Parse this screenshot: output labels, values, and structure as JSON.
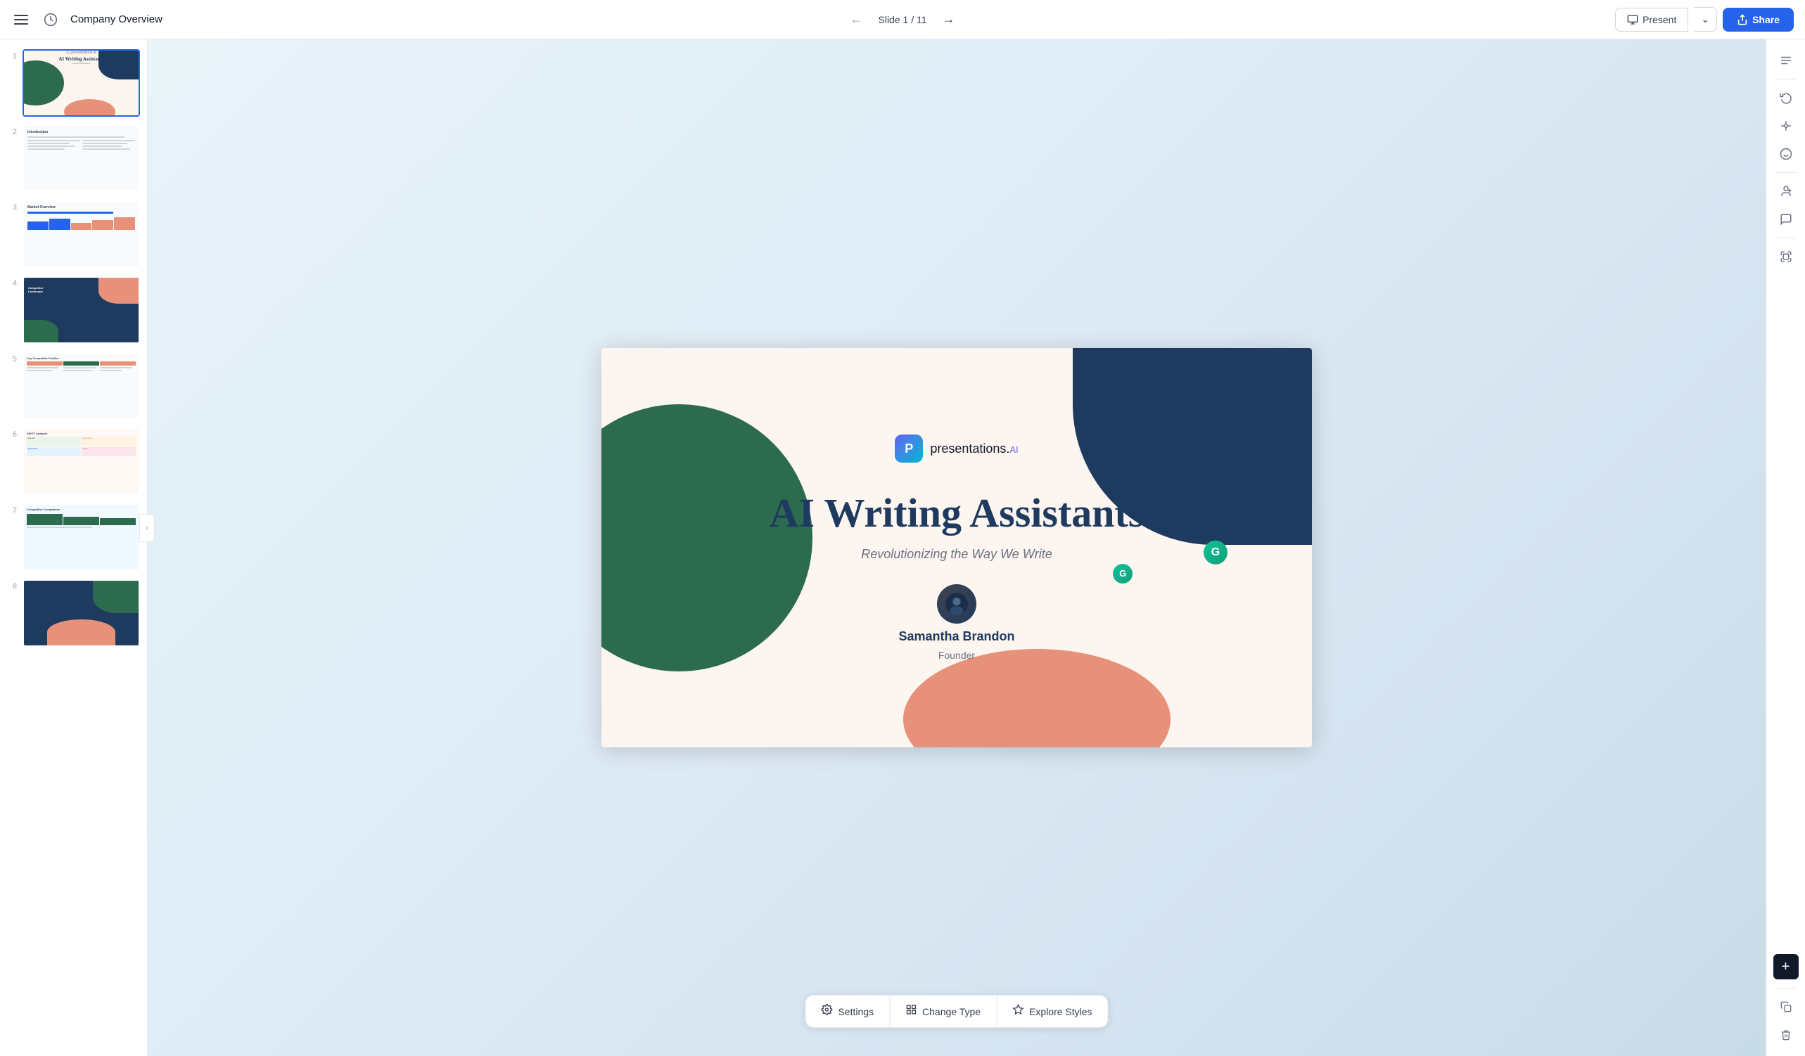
{
  "app": {
    "title": "Company Overview",
    "slide_indicator": "Slide 1 / 11",
    "present_label": "Present",
    "share_label": "Share"
  },
  "toolbar": {
    "settings_label": "Settings",
    "change_type_label": "Change Type",
    "explore_styles_label": "Explore Styles"
  },
  "slide": {
    "logo_text": "presentations.",
    "logo_ai": "AI",
    "title": "AI Writing Assistants",
    "subtitle": "Revolutionizing the Way We Write",
    "author_name": "Samantha Brandon",
    "author_role": "Founder"
  },
  "slides": [
    {
      "num": "1",
      "active": true
    },
    {
      "num": "2",
      "active": false
    },
    {
      "num": "3",
      "active": false
    },
    {
      "num": "4",
      "active": false
    },
    {
      "num": "5",
      "active": false
    },
    {
      "num": "6",
      "active": false
    },
    {
      "num": "7",
      "active": false
    },
    {
      "num": "8",
      "active": false
    }
  ],
  "right_panel": {
    "icons": [
      "≡≡",
      "↺",
      "⟷",
      "👤+",
      "💬"
    ]
  }
}
